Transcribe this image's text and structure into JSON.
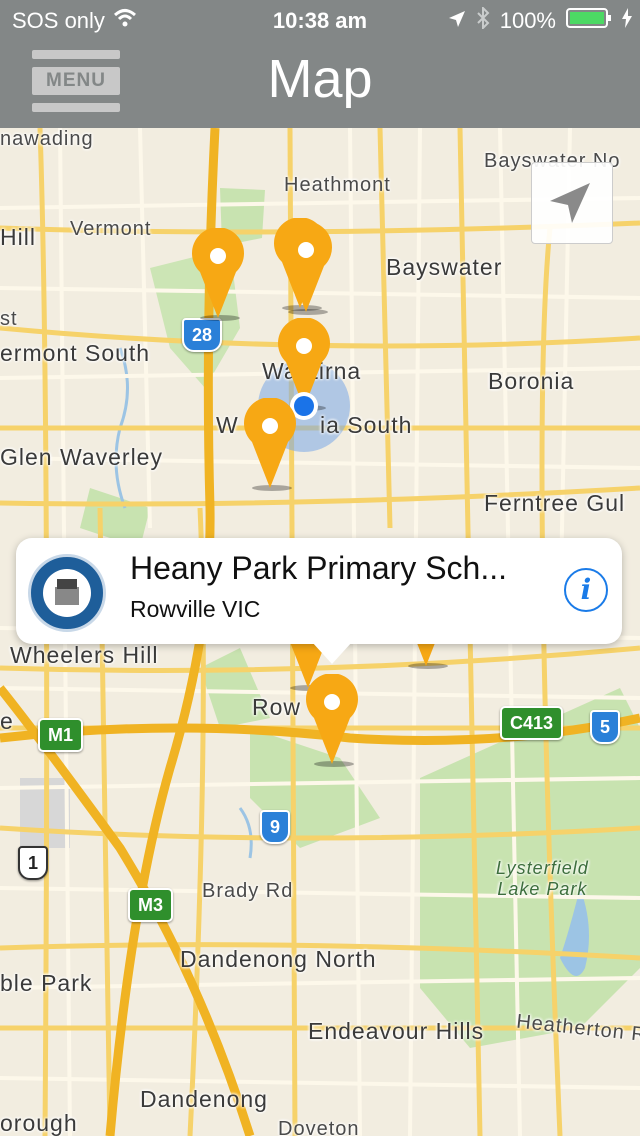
{
  "status_bar": {
    "carrier": "SOS only",
    "time": "10:38 am",
    "battery": "100%",
    "icons": [
      "wifi-icon",
      "location-arrow-icon",
      "bluetooth-icon",
      "battery-icon",
      "charging-icon"
    ]
  },
  "nav": {
    "menu_label": "MENU",
    "title": "Map"
  },
  "map": {
    "places": [
      "nawading",
      "Heathmont",
      "Bayswater No",
      "Hill",
      "Vermont",
      "Bayswater",
      "st",
      "ermont South",
      "Wantirna",
      "Boronia",
      "W",
      "ia South",
      "Glen Waverley",
      "Ferntree Gul",
      "Wheelers Hill",
      "Row",
      "e",
      "Brady Rd",
      "Dandenong North",
      "ble Park",
      "Endeavour Hills",
      "Heatherton Rd",
      "Dandenong",
      "orough",
      "Doveton"
    ],
    "park_label": "Lysterfield\nLake Park",
    "shields": [
      "28",
      "M1",
      "C413",
      "5",
      "9",
      "1",
      "M3"
    ]
  },
  "callout": {
    "title": "Heany Park Primary Sch...",
    "subtitle": "Rowville VIC",
    "info_glyph": "i"
  },
  "colors": {
    "bar": "#838787",
    "pin": "#f7a814",
    "user_dot": "#1a73e8",
    "accent": "#1a7be8"
  }
}
